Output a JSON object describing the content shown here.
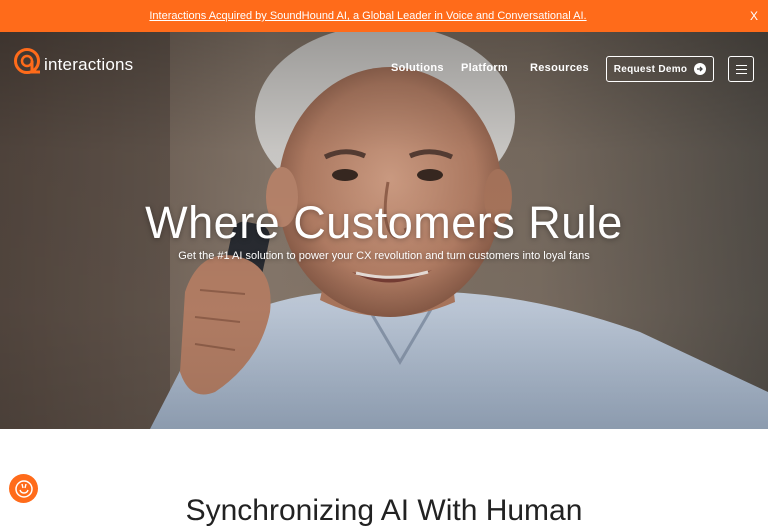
{
  "announcement": {
    "text": "Interactions Acquired by SoundHound AI, a Global Leader in Voice and Conversational AI.",
    "close": "X"
  },
  "brand": {
    "name": "interactions",
    "accent": "#ff6b1a"
  },
  "nav": {
    "items": [
      {
        "label": "Solutions"
      },
      {
        "label": "Platform"
      },
      {
        "label": "Resources"
      }
    ],
    "cta": "Request Demo"
  },
  "hero": {
    "title": "Where Customers Rule",
    "subtitle": "Get the #1 AI solution to power your CX revolution and turn customers into loyal fans"
  },
  "section": {
    "heading": "Synchronizing AI With Human"
  },
  "icons": [
    "interactions-logo-icon",
    "arrow-right-icon",
    "hamburger-menu-icon",
    "accessibility-icon"
  ]
}
